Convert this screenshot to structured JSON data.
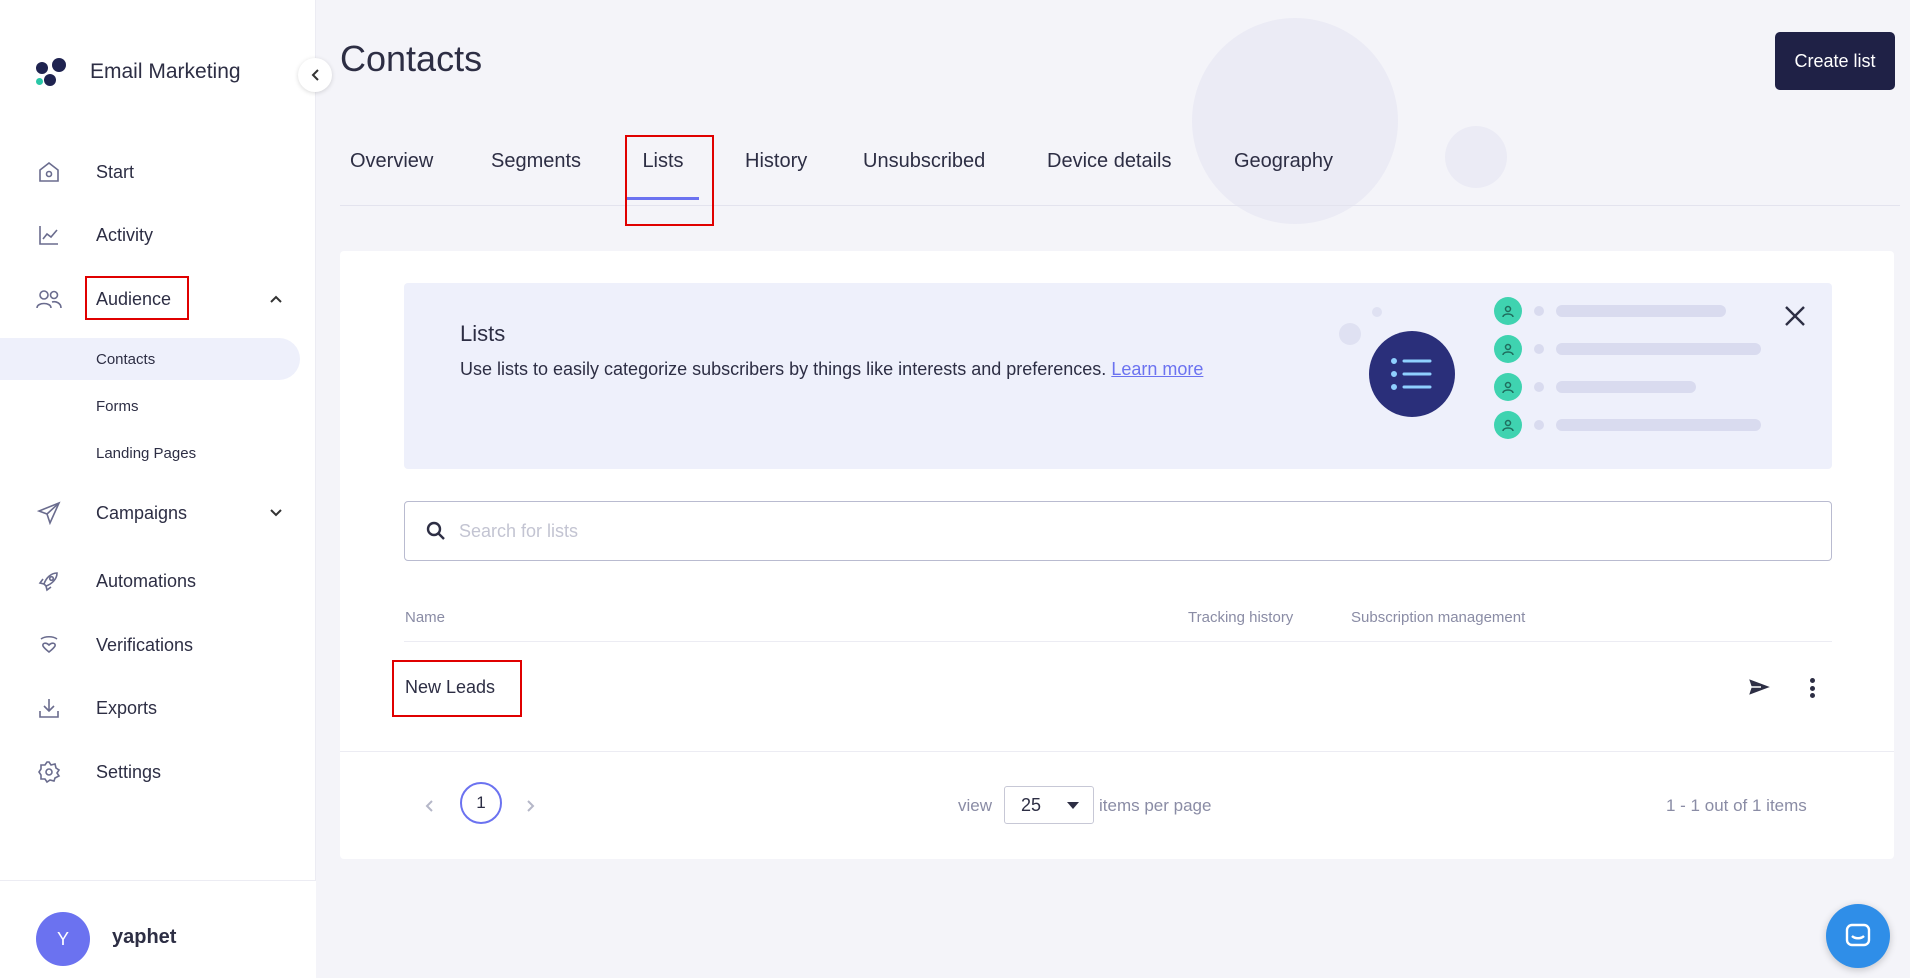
{
  "app": {
    "name": "Email Marketing"
  },
  "sidebar": {
    "items": [
      {
        "label": "Start",
        "icon": "home-icon"
      },
      {
        "label": "Activity",
        "icon": "chart-icon"
      },
      {
        "label": "Audience",
        "icon": "users-icon",
        "expanded": true
      },
      {
        "label": "Campaigns",
        "icon": "paper-plane-icon",
        "expanded": false
      },
      {
        "label": "Automations",
        "icon": "rocket-icon"
      },
      {
        "label": "Verifications",
        "icon": "heart-hand-icon"
      },
      {
        "label": "Exports",
        "icon": "download-icon"
      },
      {
        "label": "Settings",
        "icon": "gear-icon"
      }
    ],
    "audience_subitems": [
      {
        "label": "Contacts",
        "active": true
      },
      {
        "label": "Forms"
      },
      {
        "label": "Landing Pages"
      }
    ],
    "user": {
      "initial": "Y",
      "name": "yaphet"
    }
  },
  "header": {
    "title": "Contacts",
    "create_button": "Create list"
  },
  "tabs": [
    {
      "label": "Overview"
    },
    {
      "label": "Segments"
    },
    {
      "label": "Lists",
      "active": true
    },
    {
      "label": "History"
    },
    {
      "label": "Unsubscribed"
    },
    {
      "label": "Device details"
    },
    {
      "label": "Geography"
    }
  ],
  "banner": {
    "title": "Lists",
    "text": "Use lists to easily categorize subscribers by things like interests and preferences.",
    "link": "Learn more"
  },
  "search": {
    "placeholder": "Search for lists"
  },
  "table": {
    "headers": {
      "name": "Name",
      "tracking": "Tracking history",
      "subscription": "Subscription management"
    },
    "rows": [
      {
        "name": "New Leads"
      }
    ]
  },
  "pagination": {
    "current_page": "1",
    "view_label": "view",
    "page_size": "25",
    "per_page_label": "items per page",
    "summary": "1 - 1 out of 1 items"
  },
  "colors": {
    "accent": "#6b72f0",
    "primary_dark": "#1f2146",
    "highlight": "#e00000",
    "chat": "#2f8ee8",
    "teal": "#3fd3b0"
  }
}
